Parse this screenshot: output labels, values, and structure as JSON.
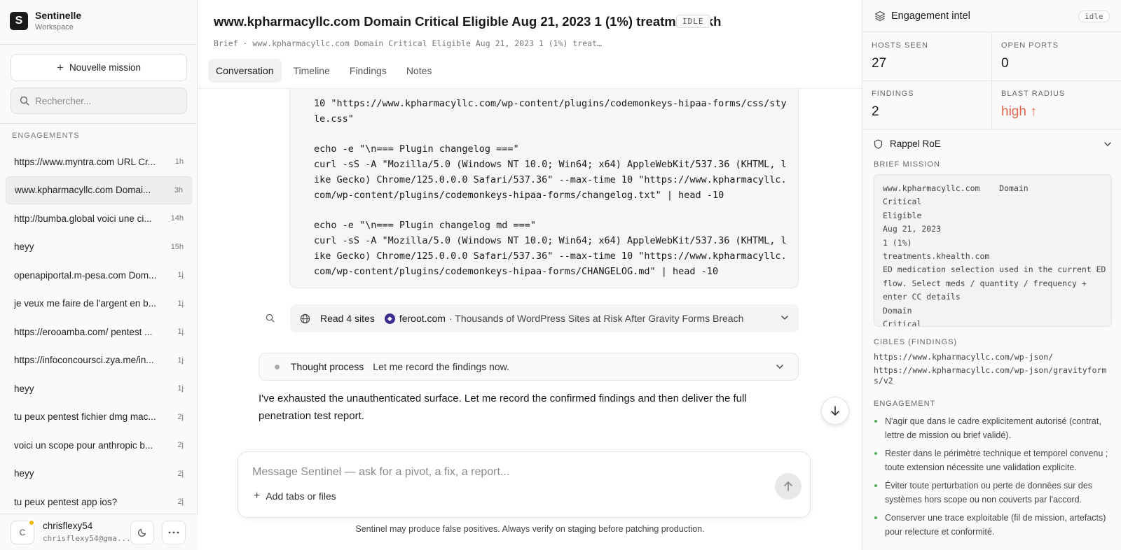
{
  "sidebar": {
    "brand": {
      "name": "Sentinelle",
      "subtitle": "Workspace"
    },
    "new_mission_label": "Nouvelle mission",
    "search_placeholder": "Rechercher...",
    "section_label": "ENGAGEMENTS",
    "items": [
      {
        "title": "https://www.myntra.com URL Cr...",
        "time": "1h"
      },
      {
        "title": "www.kpharmacyllc.com Domai...",
        "time": "3h"
      },
      {
        "title": "http://bumba.global voici une ci...",
        "time": "14h"
      },
      {
        "title": "heyy",
        "time": "15h"
      },
      {
        "title": "openapiportal.m-pesa.com Dom...",
        "time": "1j"
      },
      {
        "title": "je veux me faire de l'argent en b...",
        "time": "1j"
      },
      {
        "title": "https://erooamba.com/ pentest ...",
        "time": "1j"
      },
      {
        "title": "https://infoconcoursci.zya.me/in...",
        "time": "1j"
      },
      {
        "title": "heyy",
        "time": "1j"
      },
      {
        "title": "tu peux pentest fichier dmg mac...",
        "time": "2j"
      },
      {
        "title": "voici un scope pour anthropic b...",
        "time": "2j"
      },
      {
        "title": "heyy",
        "time": "2j"
      },
      {
        "title": "tu peux pentest app ios?",
        "time": "2j"
      }
    ],
    "user": {
      "initial": "C",
      "name": "chrisflexy54",
      "email": "chrisflexy54@gma..."
    }
  },
  "main": {
    "title": "www.kpharmacyllc.com Domain Critical Eligible Aug 21, 2023 1 (1%) treatments.kh",
    "status_badge": "IDLE",
    "breadcrumb": "Brief · www.kpharmacyllc.com Domain Critical Eligible Aug 21, 2023 1 (1%) treat…",
    "tabs": [
      "Conversation",
      "Timeline",
      "Findings",
      "Notes"
    ],
    "code": "10 \"https://www.kpharmacyllc.com/wp-content/plugins/codemonkeys-hipaa-forms/css/style.css\"\n\necho -e \"\\n=== Plugin changelog ===\"\ncurl -sS -A \"Mozilla/5.0 (Windows NT 10.0; Win64; x64) AppleWebKit/537.36 (KHTML, like Gecko) Chrome/125.0.0.0 Safari/537.36\" --max-time 10 \"https://www.kpharmacyllc.com/wp-content/plugins/codemonkeys-hipaa-forms/changelog.txt\" | head -10\n\necho -e \"\\n=== Plugin changelog md ===\"\ncurl -sS -A \"Mozilla/5.0 (Windows NT 10.0; Win64; x64) AppleWebKit/537.36 (KHTML, like Gecko) Chrome/125.0.0.0 Safari/537.36\" --max-time 10 \"https://www.kpharmacyllc.com/wp-content/plugins/codemonkeys-hipaa-forms/CHANGELOG.md\" | head -10",
    "sites": {
      "label": "Read 4 sites",
      "site_name": "feroot.com",
      "site_title": "· Thousands of WordPress Sites at Risk After Gravity Forms Breach"
    },
    "thought": {
      "label": "Thought process",
      "summary": "Let me record the findings now."
    },
    "answer": "I've exhausted the unauthenticated surface. Let me record the confirmed findings and then deliver the full penetration test report.",
    "composer": {
      "placeholder": "Message Sentinel — ask for a pivot, a fix, a report...",
      "add_label": "Add tabs or files"
    },
    "disclaimer": "Sentinel may produce false positives. Always verify on staging before patching production."
  },
  "panel": {
    "title": "Engagement intel",
    "status": "idle",
    "stats": [
      {
        "label": "HOSTS SEEN",
        "value": "27"
      },
      {
        "label": "OPEN PORTS",
        "value": "0"
      },
      {
        "label": "FINDINGS",
        "value": "2"
      },
      {
        "label": "BLAST RADIUS",
        "value": "high ↑"
      }
    ],
    "roe_title": "Rappel RoE",
    "brief_label": "BRIEF MISSION",
    "brief_text": "www.kpharmacyllc.com\tDomain\nCritical\nEligible\nAug 21, 2023\n1 (1%)\ntreatments.khealth.com\nED medication selection used in the current ED flow. Select meds / quantity / frequency + enter CC details\nDomain\nCritical",
    "targets_label": "CIBLES (FINDINGS)",
    "targets": [
      "https://www.kpharmacyllc.com/wp-json/",
      "https://www.kpharmacyllc.com/wp-json/gravityforms/v2"
    ],
    "engagement_label": "ENGAGEMENT",
    "rules": [
      "N'agir que dans le cadre explicitement autorisé (contrat, lettre de mission ou brief validé).",
      "Rester dans le périmètre technique et temporel convenu ; toute extension nécessite une validation explicite.",
      "Éviter toute perturbation ou perte de données sur des systèmes hors scope ou non couverts par l'accord.",
      "Conserver une trace exploitable (fil de mission, artefacts) pour relecture et conformité."
    ]
  },
  "colors": {
    "high": "#e0644f",
    "rule_dot": "#4caf50",
    "badge_dot": "#f2b705"
  }
}
